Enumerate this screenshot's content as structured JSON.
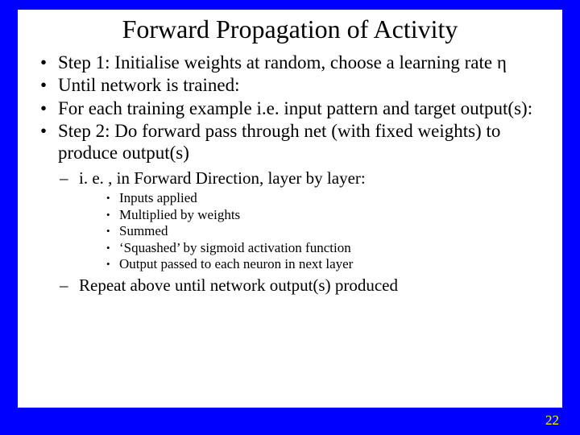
{
  "title": "Forward Propagation of Activity",
  "bullets_lvl1": [
    "Step 1: Initialise weights at random, choose a learning rate η",
    "Until network is trained:",
    "For each training example i.e. input pattern and target output(s):",
    "Step 2: Do forward pass through net (with fixed weights) to produce output(s)"
  ],
  "lvl2_a": "i. e. , in Forward Direction, layer by layer:",
  "bullets_lvl3": [
    "Inputs applied",
    "Multiplied by weights",
    "Summed",
    "‘Squashed’ by sigmoid activation function",
    "Output passed to each neuron in next layer"
  ],
  "lvl2_b": "Repeat above until network output(s) produced",
  "page_number": "22"
}
